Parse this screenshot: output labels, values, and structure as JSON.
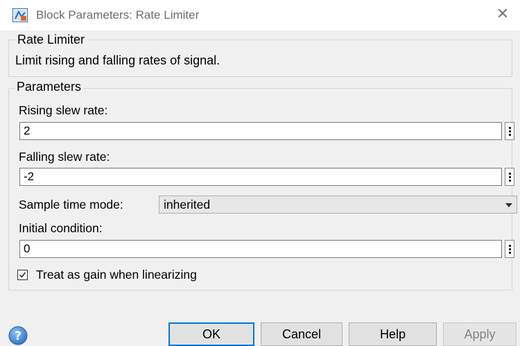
{
  "window": {
    "title": "Block Parameters: Rate Limiter",
    "close_glyph": "✕",
    "icon": "simulink-block-icon"
  },
  "block": {
    "group_title": "Rate Limiter",
    "description": "Limit rising and falling rates of signal."
  },
  "parameters": {
    "group_title": "Parameters",
    "rising_slew_rate": {
      "label": "Rising slew rate:",
      "value": "2"
    },
    "falling_slew_rate": {
      "label": "Falling slew rate:",
      "value": "-2"
    },
    "sample_time_mode": {
      "label": "Sample time mode:",
      "selected": "inherited"
    },
    "initial_condition": {
      "label": "Initial condition:",
      "value": "0"
    },
    "treat_as_gain": {
      "label": "Treat as gain when linearizing",
      "checked": true
    }
  },
  "buttons": {
    "ok": "OK",
    "cancel": "Cancel",
    "help": "Help",
    "apply": "Apply"
  },
  "colors": {
    "focus_border": "#0078d7",
    "help_icon": "#3c8ee0"
  }
}
